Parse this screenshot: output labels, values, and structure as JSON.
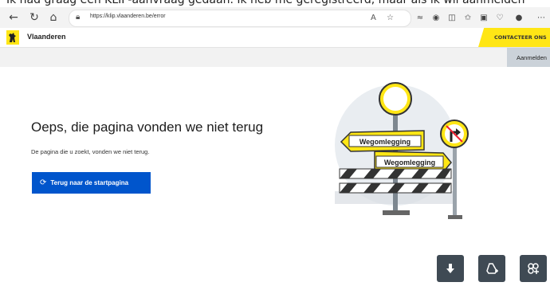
{
  "caption": {
    "text": "Ik had graag een KLIP-aanvraag gedaan. Ik heb me geregistreerd, maar als ik wil aanmelden"
  },
  "browser": {
    "url": "https://klip.vlaanderen.be/error",
    "icons": [
      "back-icon",
      "refresh-icon",
      "home-icon",
      "lock-icon",
      "read-aloud-icon",
      "favorite-icon",
      "extension-icon",
      "copilot-icon",
      "split-screen-icon",
      "favorites-icon",
      "collections-icon",
      "browser-essentials-icon",
      "profile-icon"
    ]
  },
  "site": {
    "brand": "Vlaanderen",
    "contact_label": "CONTACTEER ONS",
    "login_label": "Aanmelden",
    "accent_color": "#ffe615"
  },
  "main": {
    "title": "Oeps, die pagina vonden we niet terug",
    "description": "De pagina die u zoekt, vonden we niet terug.",
    "button_label": "Terug naar de startpagina",
    "button_color": "#0055cc"
  },
  "illustration": {
    "sign_top": "Wegomlegging",
    "sign_bottom": "Wegomlegging"
  },
  "floating_buttons": [
    "download-icon",
    "add-drive-icon",
    "add-app-icon"
  ]
}
